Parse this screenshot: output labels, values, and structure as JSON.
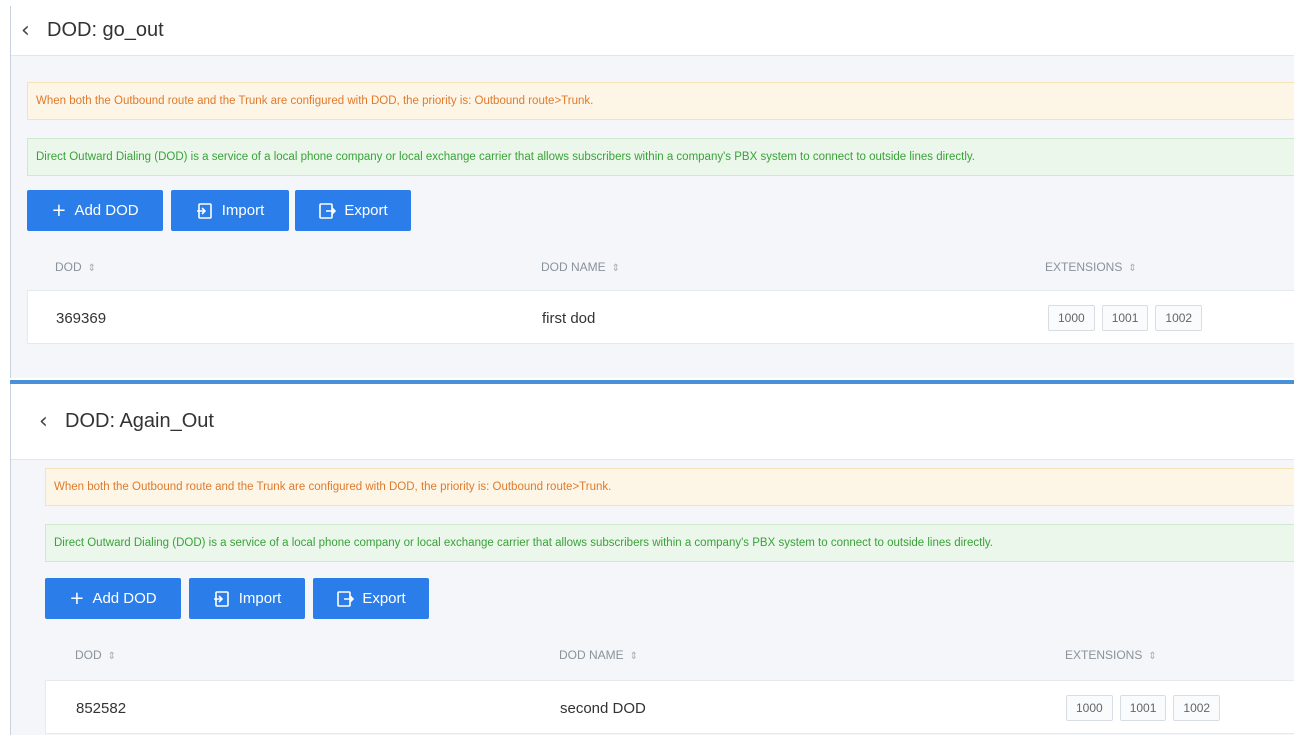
{
  "panels": [
    {
      "title": "DOD: go_out",
      "warning": "When both the Outbound route and the Trunk are configured with DOD, the priority is: Outbound route>Trunk.",
      "info": "Direct Outward Dialing (DOD) is a service of a local phone company or local exchange carrier that allows subscribers within a company's PBX system to connect to outside lines directly.",
      "buttons": {
        "add": "Add DOD",
        "import": "Import",
        "export": "Export"
      },
      "columns": {
        "dod": "DOD",
        "name": "DOD NAME",
        "extensions": "EXTENSIONS"
      },
      "row": {
        "dod": "369369",
        "name": "first dod",
        "extensions": [
          "1000",
          "1001",
          "1002"
        ]
      }
    },
    {
      "title": "DOD: Again_Out",
      "warning": "When both the Outbound route and the Trunk are configured with DOD, the priority is: Outbound route>Trunk.",
      "info": "Direct Outward Dialing (DOD) is a service of a local phone company or local exchange carrier that allows subscribers within a company's PBX system to connect to outside lines directly.",
      "buttons": {
        "add": "Add DOD",
        "import": "Import",
        "export": "Export"
      },
      "columns": {
        "dod": "DOD",
        "name": "DOD NAME",
        "extensions": "EXTENSIONS"
      },
      "row": {
        "dod": "852582",
        "name": "second DOD",
        "extensions": [
          "1000",
          "1001",
          "1002"
        ]
      }
    }
  ],
  "icons": {
    "back": "chevron-left-icon",
    "add": "plus-icon",
    "import": "import-icon",
    "export": "export-icon",
    "sort": "sort-icon"
  },
  "colors": {
    "primary_button": "#2b7de9",
    "warning_text": "#e07a2c",
    "info_text": "#3aa23a",
    "divider": "#4a90d9"
  }
}
